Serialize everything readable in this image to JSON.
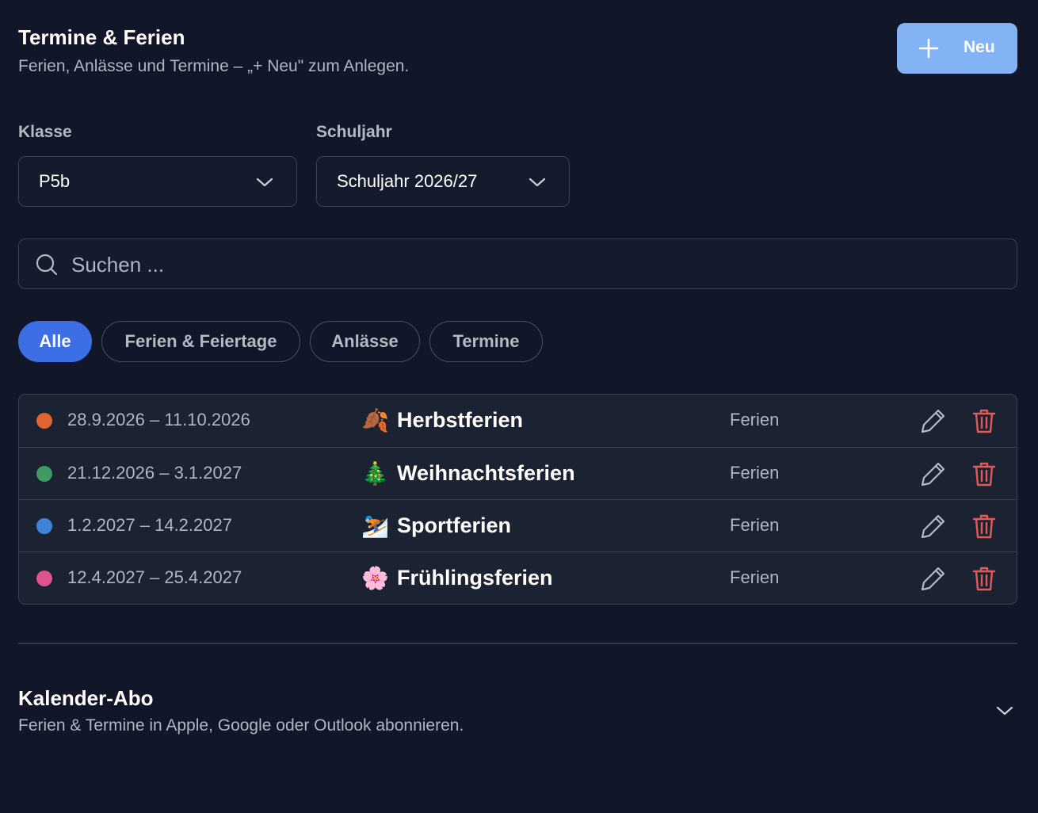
{
  "header": {
    "title": "Termine & Ferien",
    "subtitle": "Ferien, Anlässe und Termine – „+ Neu\" zum Anlegen.",
    "new_button_label": "Neu",
    "new_button_icon": "plus-icon"
  },
  "filters": {
    "class_label": "Klasse",
    "class_value": "P5b",
    "year_label": "Schuljahr",
    "year_value": "Schuljahr 2026/27"
  },
  "search": {
    "placeholder": "Suchen ...",
    "value": ""
  },
  "chips": [
    {
      "label": "Alle",
      "active": true
    },
    {
      "label": "Ferien & Feiertage",
      "active": false
    },
    {
      "label": "Anlässe",
      "active": false
    },
    {
      "label": "Termine",
      "active": false
    }
  ],
  "events": [
    {
      "dates": "28.9.2026 – 11.10.2026",
      "emoji": "🍂",
      "name": "Herbstferien",
      "type": "Ferien",
      "color": "#e0642f"
    },
    {
      "dates": "21.12.2026 – 3.1.2027",
      "emoji": "🎄",
      "name": "Weihnachtsferien",
      "type": "Ferien",
      "color": "#3f9a63"
    },
    {
      "dates": "1.2.2027 – 14.2.2027",
      "emoji": "⛷️",
      "name": "Sportferien",
      "type": "Ferien",
      "color": "#3e83d5"
    },
    {
      "dates": "12.4.2027 – 25.4.2027",
      "emoji": "🌸",
      "name": "Frühlingsferien",
      "type": "Ferien",
      "color": "#e0518f"
    }
  ],
  "calendar_subscription": {
    "title": "Kalender-Abo",
    "subtitle": "Ferien & Termine in Apple, Google oder Outlook abonnieren."
  },
  "colors": {
    "background": "#111728",
    "primary_button": "#83b3f4",
    "active_chip": "#3c6ee6",
    "delete_icon": "#e05a5a"
  }
}
